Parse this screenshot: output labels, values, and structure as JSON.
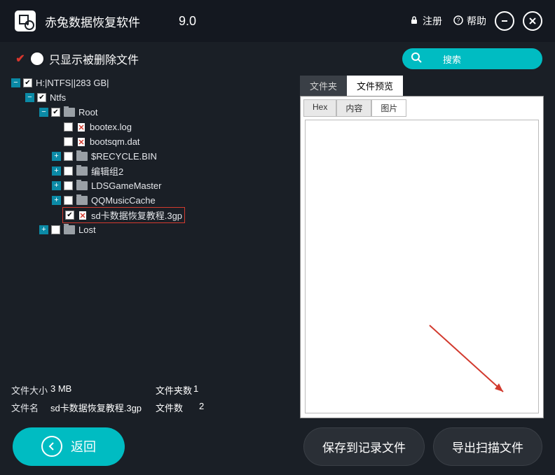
{
  "header": {
    "app_title": "赤兔数据恢复软件",
    "version": "9.0",
    "register": "注册",
    "help": "帮助"
  },
  "toolbar": {
    "filter_label": "只显示被删除文件",
    "search_placeholder": "搜索"
  },
  "tree": {
    "root": "H:|NTFS||283 GB|",
    "ntfs": "Ntfs",
    "rootfolder": "Root",
    "bootex": "bootex.log",
    "bootsqm": "bootsqm.dat",
    "recycle": "$RECYCLE.BIN",
    "bianji": "编辑组2",
    "lds": "LDSGameMaster",
    "qq": "QQMusicCache",
    "sdfile": "sd卡数据恢复教程.3gp",
    "lost": "Lost"
  },
  "stats": {
    "size_label": "文件大小",
    "size_value": "3 MB",
    "folders_label": "文件夹数",
    "folders_value": "1",
    "name_label": "文件名",
    "name_value": "sd卡数据恢复教程.3gp",
    "files_label": "文件数",
    "files_value": "2"
  },
  "tabs": {
    "folder": "文件夹",
    "preview": "文件预览",
    "hex": "Hex",
    "content": "内容",
    "image": "图片"
  },
  "buttons": {
    "back": "返回",
    "save_log": "保存到记录文件",
    "export": "导出扫描文件"
  }
}
